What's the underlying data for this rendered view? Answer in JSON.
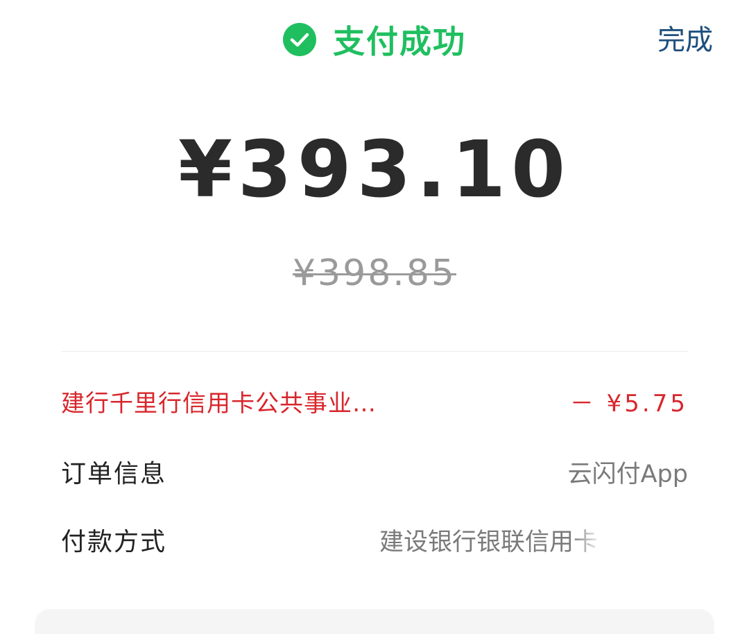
{
  "header": {
    "status_text": "支付成功",
    "status_icon": "check-circle-icon",
    "done_label": "完成"
  },
  "amount": {
    "paid": "¥393.10",
    "original": "¥398.85"
  },
  "discount": {
    "name": "建行千里行信用卡公共事业…",
    "value": "－ ¥5.75"
  },
  "order_info": {
    "label": "订单信息",
    "value": "云闪付App"
  },
  "payment_method": {
    "label": "付款方式",
    "value": "建设银行银联信用卡"
  },
  "colors": {
    "success": "#1fbf5f",
    "done_link": "#1d4f7e",
    "discount": "#d8262c",
    "amount": "#2b2b2b",
    "muted": "#9a9a9a"
  }
}
